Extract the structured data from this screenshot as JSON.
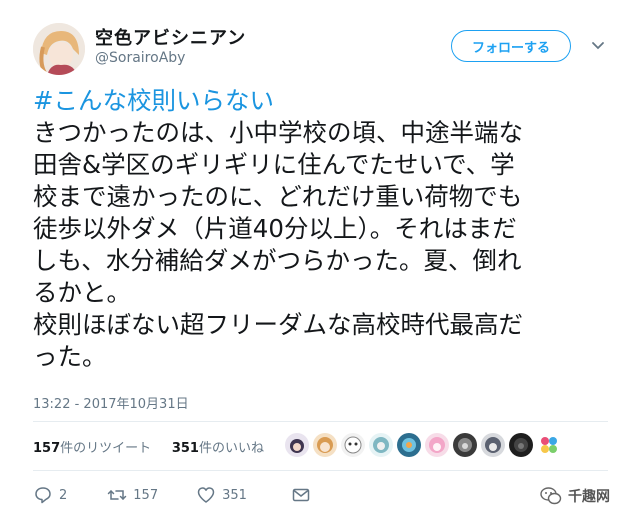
{
  "user": {
    "display_name": "空色アビシニアン",
    "handle": "@SorairoAby"
  },
  "follow_label": "フォローする",
  "tweet": {
    "hashtag": "#こんな校則いらない",
    "lines": [
      "きつかったのは、小中学校の頃、中途半端な",
      "田舎&学区のギリギリに住んでたせいで、学",
      "校まで遠かったのに、どれだけ重い荷物でも",
      "徒歩以外ダメ（片道40分以上）。それはまだ",
      "しも、水分補給ダメがつらかった。夏、倒れ",
      "るかと。",
      "校則ほぼない超フリーダムな高校時代最高だ",
      "った。"
    ]
  },
  "timestamp": "13:22 - 2017年10月31日",
  "stats": {
    "retweet_count": "157",
    "retweet_label": "件のリツイート",
    "like_count": "351",
    "like_label": "件のいいね"
  },
  "liker_avatars": [
    "avatar-1",
    "avatar-2",
    "avatar-3",
    "avatar-4",
    "avatar-5",
    "avatar-6",
    "avatar-7",
    "avatar-8",
    "avatar-9",
    "avatar-10"
  ],
  "actions": {
    "reply_count": "2",
    "retweet_count": "157",
    "like_count": "351"
  },
  "watermark": "千趣网",
  "colors": {
    "accent": "#1da1f2",
    "hashtag": "#1b95e0",
    "muted": "#657786"
  }
}
